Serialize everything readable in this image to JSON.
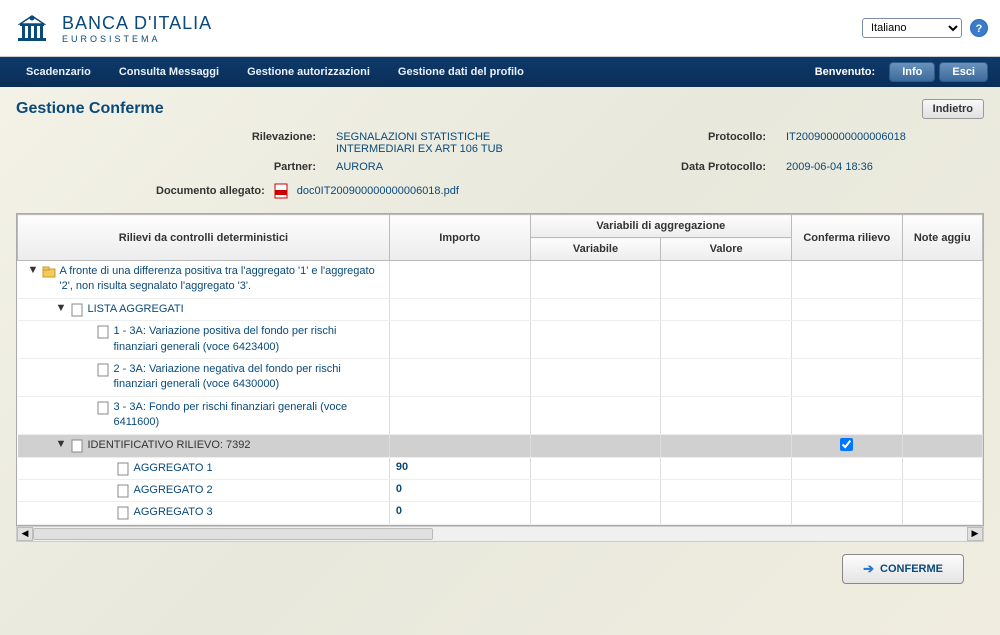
{
  "brand": {
    "name": "BANCA D'ITALIA",
    "sub": "EUROSISTEMA"
  },
  "language": {
    "selected": "Italiano"
  },
  "nav": {
    "items": [
      "Scadenzario",
      "Consulta Messaggi",
      "Gestione autorizzazioni",
      "Gestione dati del profilo"
    ],
    "welcome": "Benvenuto:",
    "info": "Info",
    "exit": "Esci"
  },
  "page": {
    "title": "Gestione Conferme",
    "back": "Indietro"
  },
  "info": {
    "rilevazione_label": "Rilevazione:",
    "rilevazione_value1": "SEGNALAZIONI STATISTICHE",
    "rilevazione_value2": "INTERMEDIARI EX ART 106 TUB",
    "partner_label": "Partner:",
    "partner_value": "AURORA",
    "protocollo_label": "Protocollo:",
    "protocollo_value": "IT200900000000006018",
    "data_label": "Data Protocollo:",
    "data_value": "2009-06-04 18:36",
    "doc_label": "Documento allegato:",
    "doc_name": "doc0IT200900000000006018.pdf"
  },
  "columns": {
    "rilievi": "Rilievi da controlli deterministici",
    "importo": "Importo",
    "vars_group": "Variabili di aggregazione",
    "variabile": "Variabile",
    "valore": "Valore",
    "conferma": "Conferma rilievo",
    "note": "Note aggiu"
  },
  "tree": {
    "root": "A fronte di una differenza positiva tra l'aggregato '1' e l'aggregato '2', non risulta segnalato l'aggregato '3'.",
    "lista": "LISTA AGGREGATI",
    "item1": "1 - 3A: Variazione positiva del fondo per rischi finanziari generali (voce 6423400)",
    "item2": "2 - 3A: Variazione negativa del fondo per rischi finanziari generali (voce 6430000)",
    "item3": "3 - 3A: Fondo per rischi finanziari generali (voce 6411600)",
    "id_rilievo": "IDENTIFICATIVO RILIEVO: 7392",
    "agg1": "AGGREGATO 1",
    "agg1_val": "90",
    "agg2": "AGGREGATO 2",
    "agg2_val": "0",
    "agg3": "AGGREGATO 3",
    "agg3_val": "0"
  },
  "actions": {
    "conferme": "CONFERME"
  }
}
